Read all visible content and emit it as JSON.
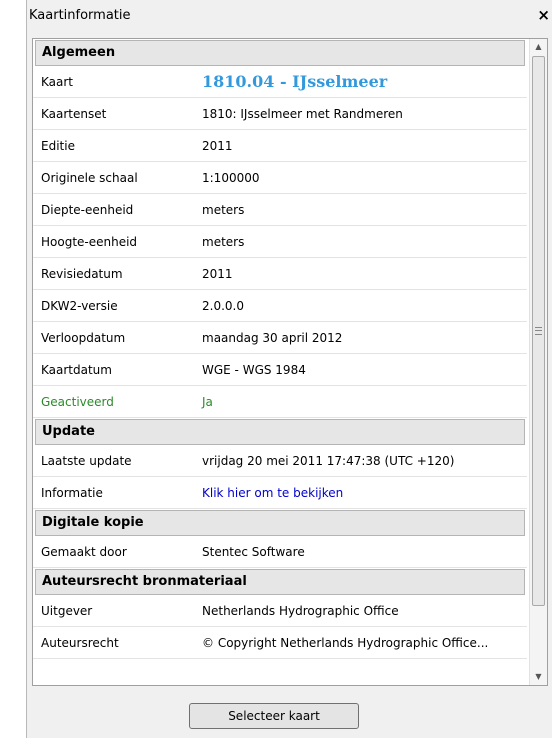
{
  "window": {
    "title": "Kaartinformatie",
    "close_glyph": "×"
  },
  "sections": {
    "algemeen": "Algemeen",
    "update": "Update",
    "digitale": "Digitale kopie",
    "auteursrecht": "Auteursrecht bronmateriaal"
  },
  "rows": [
    {
      "label": "Kaart",
      "value": "1810.04 - IJsselmeer"
    },
    {
      "label": "Kaartenset",
      "value": "1810: IJsselmeer met Randmeren"
    },
    {
      "label": "Editie",
      "value": "2011"
    },
    {
      "label": "Originele schaal",
      "value": "1:100000"
    },
    {
      "label": "Diepte-eenheid",
      "value": "meters"
    },
    {
      "label": "Hoogte-eenheid",
      "value": "meters"
    },
    {
      "label": "Revisiedatum",
      "value": "2011"
    },
    {
      "label": "DKW2-versie",
      "value": "2.0.0.0"
    },
    {
      "label": "Verloopdatum",
      "value": "maandag 30 april 2012"
    },
    {
      "label": "Kaartdatum",
      "value": "WGE - WGS 1984"
    },
    {
      "label": "Geactiveerd",
      "value": "Ja"
    },
    {
      "label": "Laatste update",
      "value": "vrijdag 20 mei 2011 17:47:38 (UTC +120)"
    },
    {
      "label": "Informatie",
      "value": "Klik hier om te bekijken"
    },
    {
      "label": "Gemaakt door",
      "value": "Stentec Software"
    },
    {
      "label": "Uitgever",
      "value": "Netherlands Hydrographic Office"
    },
    {
      "label": "Auteursrecht",
      "value": "© Copyright Netherlands Hydrographic Office..."
    }
  ],
  "button": {
    "select_label": "Selecteer kaart"
  },
  "colors": {
    "chart_title": "#3399dd",
    "activated": "#2a8a2a",
    "link": "#0000cc"
  },
  "icons": {
    "close": "close-icon",
    "scroll_up": "scroll-up-icon",
    "scroll_down": "scroll-down-icon"
  }
}
